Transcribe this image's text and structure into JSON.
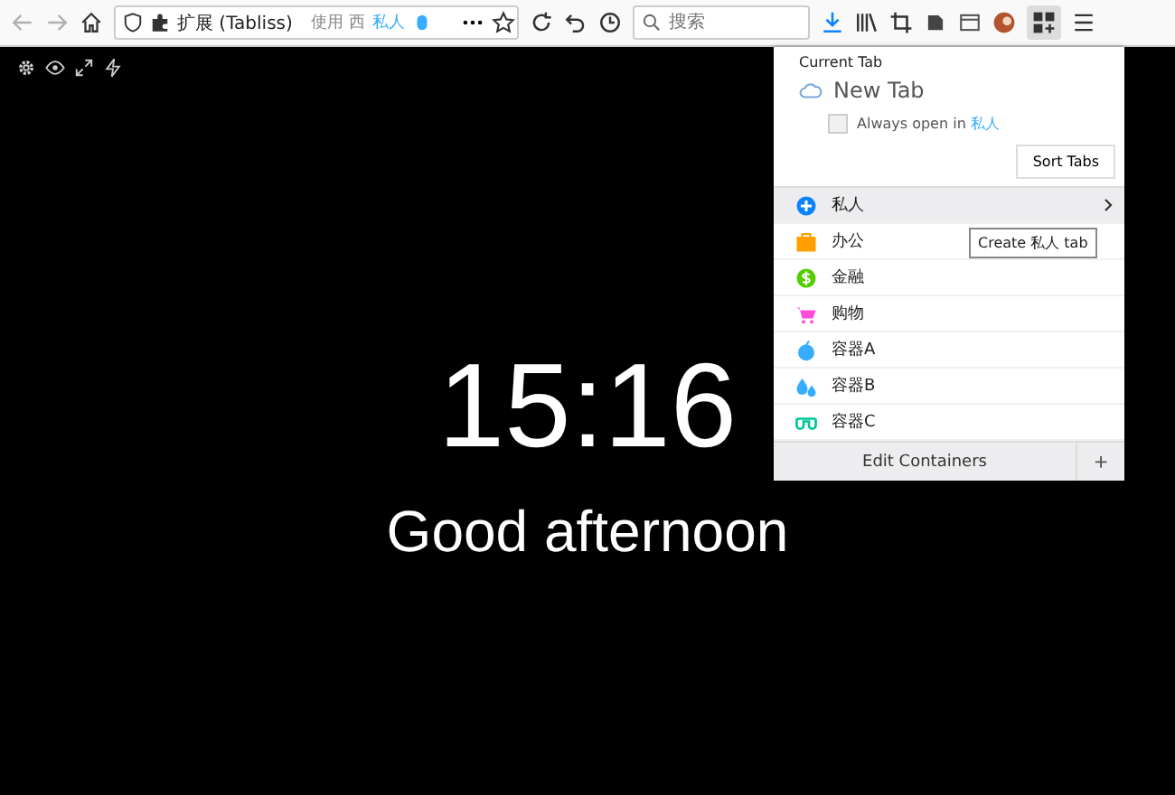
{
  "toolbar": {
    "url_label": "扩展 (Tabliss)",
    "url_hint": "使用 西",
    "container_badge": "私人",
    "search": {
      "placeholder": "搜索"
    }
  },
  "canvas": {
    "time": "15:16",
    "greeting": "Good afternoon"
  },
  "popup": {
    "heading": "Current Tab",
    "tab_title": "New Tab",
    "always_open": {
      "label": "Always open in ",
      "container": "私人",
      "checked": false
    },
    "sort_button": "Sort Tabs",
    "containers": [
      {
        "name": "私人",
        "kind": "plus",
        "color": "#0a84ff",
        "selected": true
      },
      {
        "name": "办公",
        "kind": "briefcase",
        "color": "#ff9f00",
        "selected": false
      },
      {
        "name": "金融",
        "kind": "dollar",
        "color": "#51cd00",
        "selected": false
      },
      {
        "name": "购物",
        "kind": "cart",
        "color": "#ff4bda",
        "selected": false
      },
      {
        "name": "容器A",
        "kind": "fruit",
        "color": "#37adff",
        "selected": false
      },
      {
        "name": "容器B",
        "kind": "drops",
        "color": "#37adff",
        "selected": false
      },
      {
        "name": "容器C",
        "kind": "glasses",
        "color": "#00c79a",
        "selected": false
      }
    ],
    "tooltip": "Create 私人 tab",
    "edit_button": "Edit Containers",
    "add_button": "+"
  }
}
